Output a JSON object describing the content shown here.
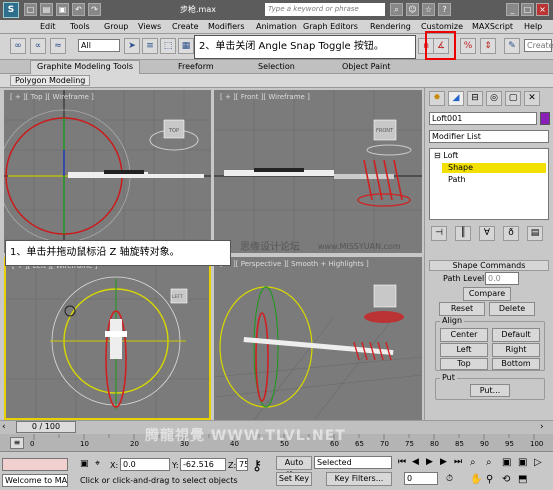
{
  "title_bar": {
    "logo": "S",
    "file_title": "步枪.max",
    "search_placeholder": "Type a keyword or phrase",
    "help_label": "?"
  },
  "menu": [
    "Edit",
    "Tools",
    "Group",
    "Views",
    "Create",
    "Modifiers",
    "Animation",
    "Graph Editors",
    "Rendering",
    "Customize",
    "MAXScript",
    "Help"
  ],
  "toolbar": {
    "selection_filter": "All",
    "create_selection_label": "Create"
  },
  "callouts": {
    "step2": "2、单击关闭 Angle Snap Toggle 按钮。",
    "step1": "1、单击并拖动鼠标沿 Z 轴旋转对象。"
  },
  "ribbon": {
    "tabs": [
      "Graphite Modeling Tools",
      "Freeform",
      "Selection",
      "Object Paint"
    ],
    "sub_tab": "Polygon Modeling"
  },
  "viewports": {
    "top": "[ + ][ Top ][ Wireframe ]",
    "front": "[ + ][ Front ][ Wireframe ]",
    "left": "[ + ][ Left ][ Wireframe ]",
    "perspective": "[ + ][ Perspective ][ Smooth + Highlights ]",
    "cube_top": "TOP",
    "cube_front": "FRONT",
    "cube_left": "LEFT"
  },
  "watermarks": {
    "site1": "思缘设计论坛",
    "site1_url": "www.MISSYUAN.com",
    "site2": "腾龍視覺 WWW.TLVL.NET"
  },
  "command_panel": {
    "object_name": "Loft001",
    "object_color": "#8a1fb8",
    "modifier_list": "Modifier List",
    "stack": [
      "Loft",
      "Shape",
      "Path"
    ],
    "rollout_title": "Shape Commands",
    "path_level_label": "Path Level:",
    "path_level_value": "0.0",
    "compare": "Compare",
    "reset": "Reset",
    "delete": "Delete",
    "align_label": "Align",
    "align_buttons": [
      "Center",
      "Default",
      "Left",
      "Right",
      "Top",
      "Bottom"
    ],
    "put_label": "Put",
    "put_button": "Put..."
  },
  "timeline": {
    "frame": "0 / 100",
    "ticks": [
      "0",
      "10",
      "20",
      "30",
      "40",
      "50",
      "60",
      "65",
      "70",
      "75",
      "80",
      "85",
      "90",
      "95",
      "100"
    ]
  },
  "status": {
    "maxscript": "Welcome to MAX",
    "prompt": "Click or click-and-drag to select objects",
    "x_label": "X:",
    "x_value": "0.0",
    "y_label": "Y:",
    "y_value": "-62.516",
    "z_label": "Z:",
    "z_value": "75",
    "auto_key": "Auto Key",
    "set_key": "Set Key",
    "key_mode": "Selected",
    "key_filters": "Key Filters...",
    "frame_field": "0"
  }
}
